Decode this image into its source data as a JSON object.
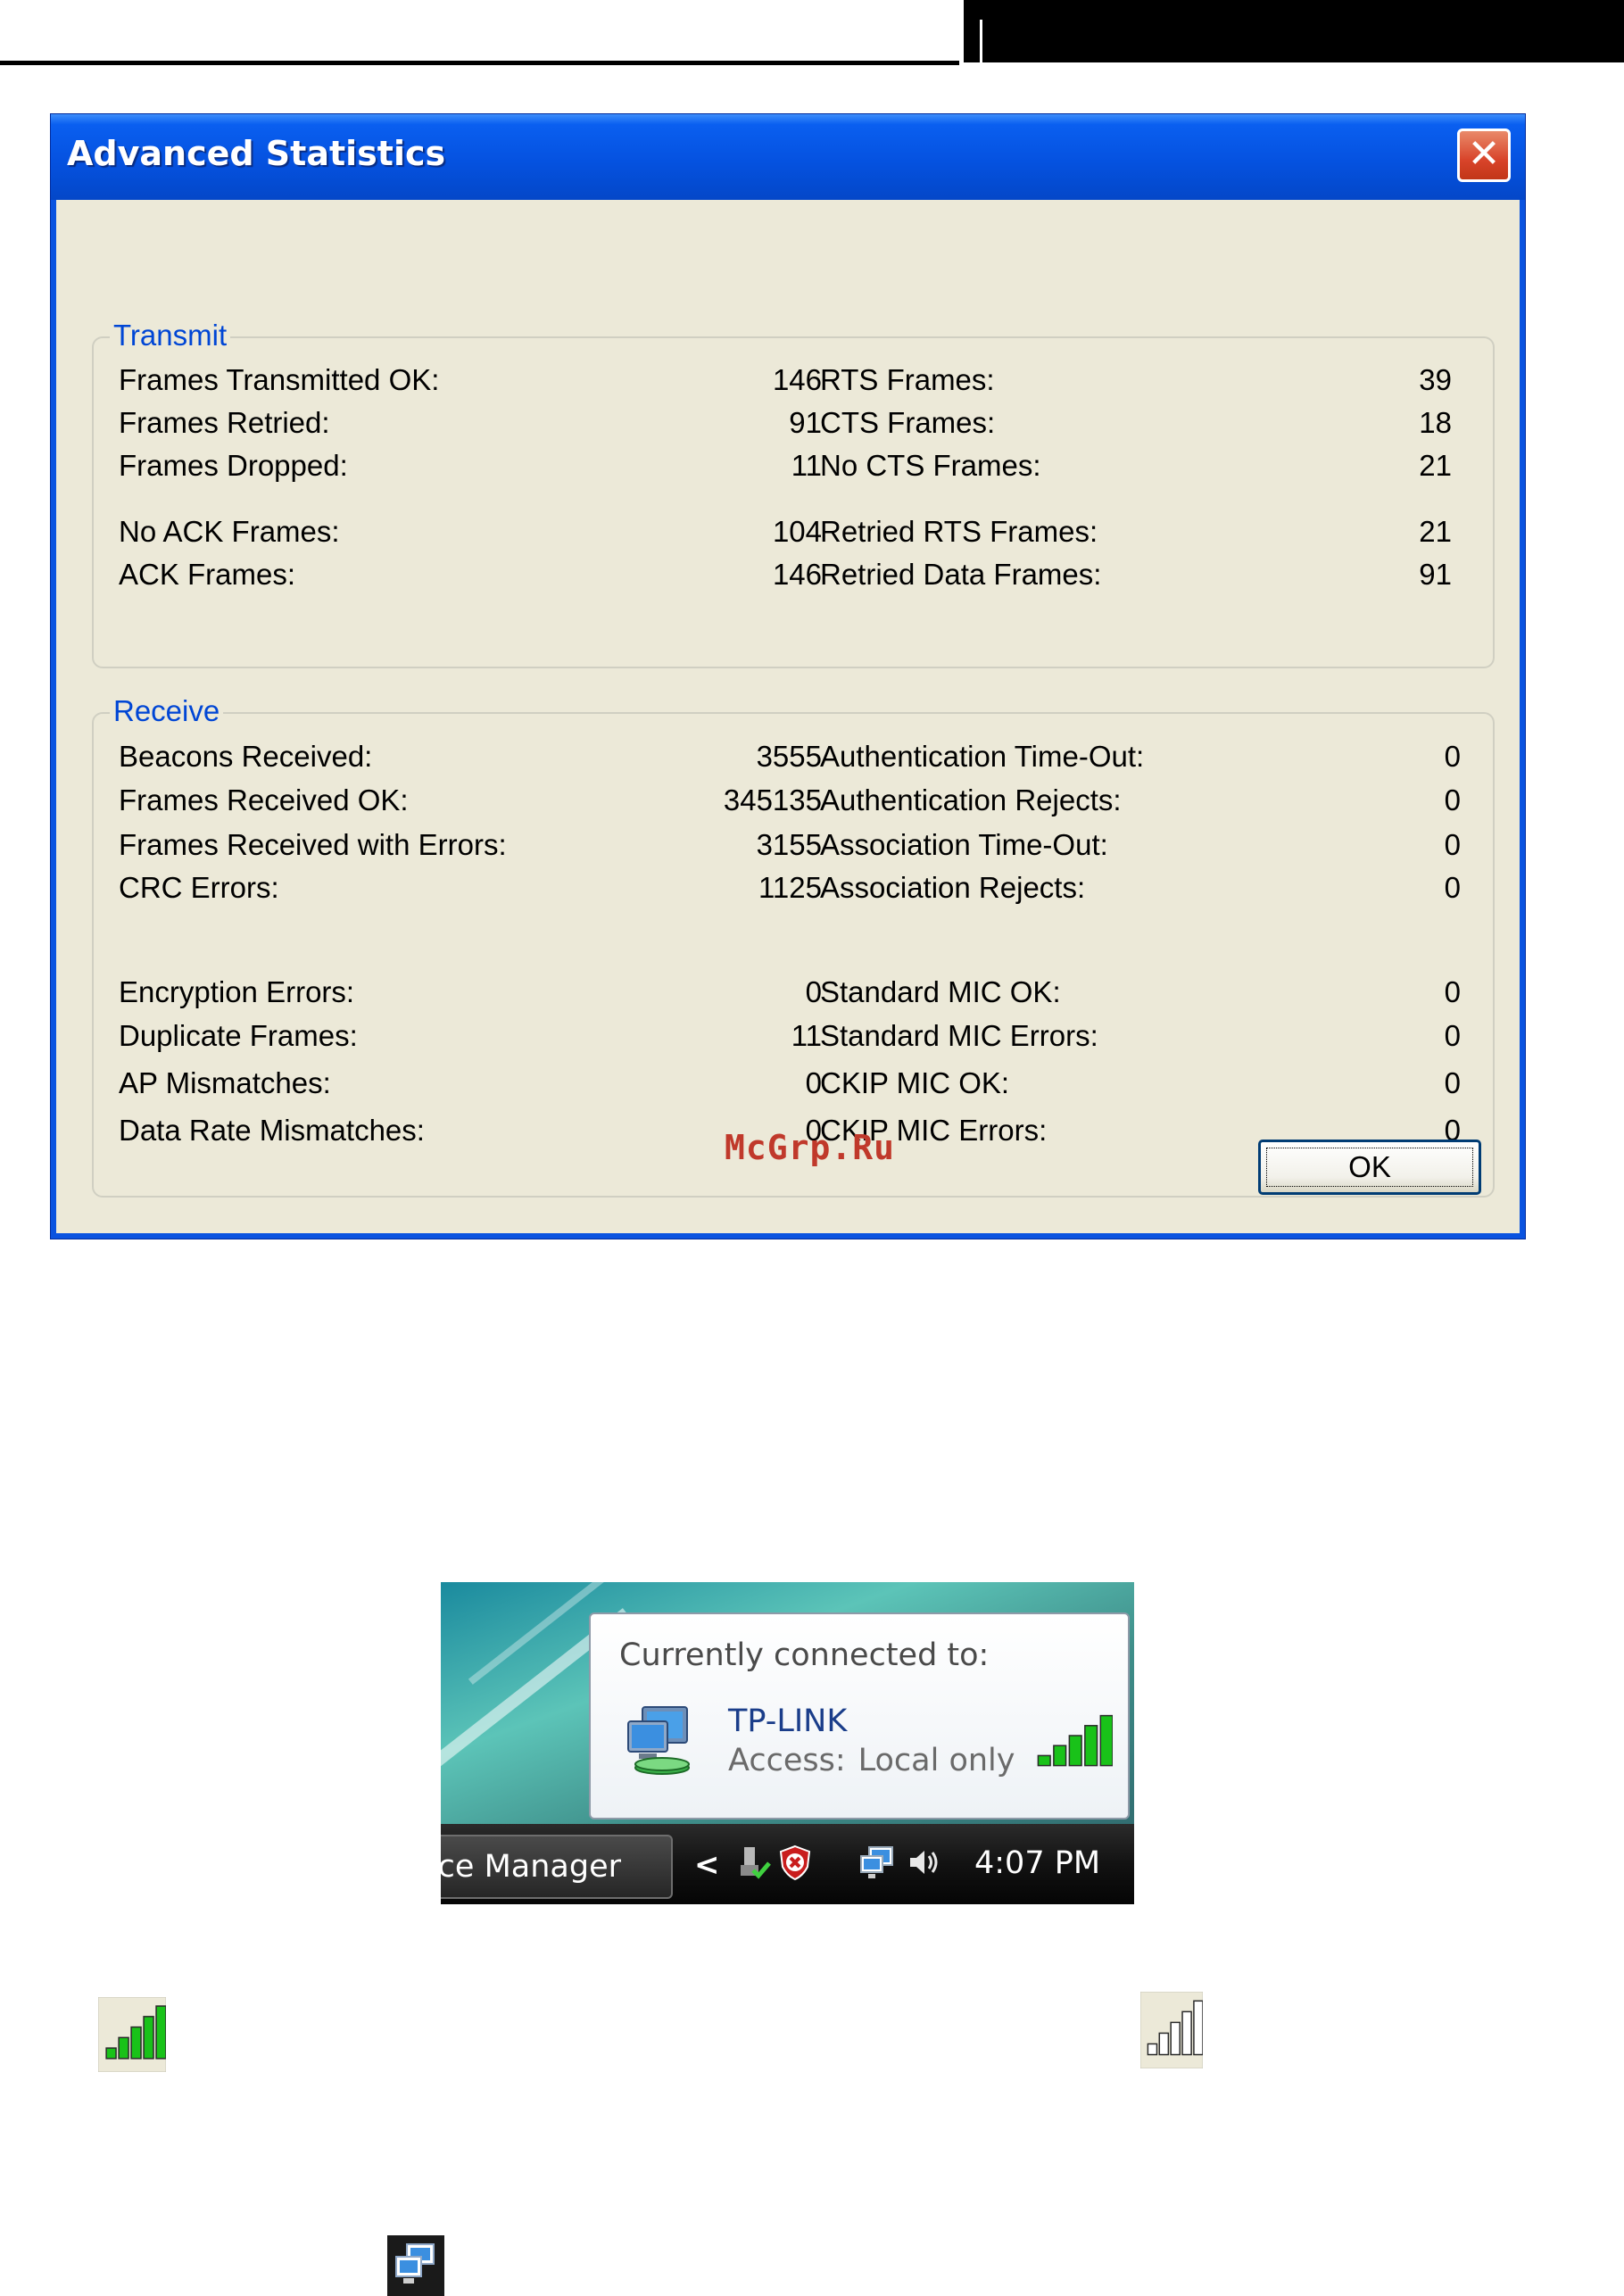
{
  "dialog": {
    "title": "Advanced Statistics",
    "close_glyph": "✕",
    "ok_label": "OK",
    "watermark": "McGrp.Ru"
  },
  "transmit": {
    "label": "Transmit",
    "left": [
      {
        "label": "Frames Transmitted OK:",
        "value": "146"
      },
      {
        "label": "Frames Retried:",
        "value": "91"
      },
      {
        "label": "Frames Dropped:",
        "value": "11"
      },
      {
        "label": "No ACK Frames:",
        "value": "104"
      },
      {
        "label": "ACK Frames:",
        "value": "146"
      }
    ],
    "right": [
      {
        "label": "RTS Frames:",
        "value": "39"
      },
      {
        "label": "CTS Frames:",
        "value": "18"
      },
      {
        "label": "No CTS Frames:",
        "value": "21"
      },
      {
        "label": "Retried RTS Frames:",
        "value": "21"
      },
      {
        "label": "Retried Data Frames:",
        "value": "91"
      }
    ]
  },
  "receive": {
    "label": "Receive",
    "left": [
      {
        "label": "Beacons Received:",
        "value": "3555"
      },
      {
        "label": "Frames Received OK:",
        "value": "345135"
      },
      {
        "label": "Frames Received with Errors:",
        "value": "3155"
      },
      {
        "label": "CRC Errors:",
        "value": "1125"
      },
      {
        "label": "Encryption Errors:",
        "value": "0"
      },
      {
        "label": "Duplicate Frames:",
        "value": "11"
      },
      {
        "label": "AP Mismatches:",
        "value": "0"
      },
      {
        "label": "Data Rate Mismatches:",
        "value": "0"
      }
    ],
    "right": [
      {
        "label": "Authentication Time-Out:",
        "value": "0"
      },
      {
        "label": "Authentication Rejects:",
        "value": "0"
      },
      {
        "label": "Association Time-Out:",
        "value": "0"
      },
      {
        "label": "Association Rejects:",
        "value": "0"
      },
      {
        "label": "Standard MIC OK:",
        "value": "0"
      },
      {
        "label": "Standard MIC Errors:",
        "value": "0"
      },
      {
        "label": "CKIP MIC OK:",
        "value": "0"
      },
      {
        "label": "CKIP MIC Errors:",
        "value": "0"
      }
    ]
  },
  "tray_popup": {
    "title": "Currently connected to:",
    "network_name": "TP-LINK",
    "access_label": "Access:",
    "access_value": "Local only",
    "signal_bars": 5
  },
  "taskbar": {
    "task_button": "vice Manager",
    "chevron": "<",
    "clock": "4:07 PM"
  },
  "icons": {
    "signal_strong_bars": 5,
    "signal_none_bars": 0,
    "colors": {
      "signal_on": "#19c219",
      "signal_off": "#ffffff",
      "xp_blue": "#0a53e0",
      "group_label": "#0046d5"
    }
  }
}
